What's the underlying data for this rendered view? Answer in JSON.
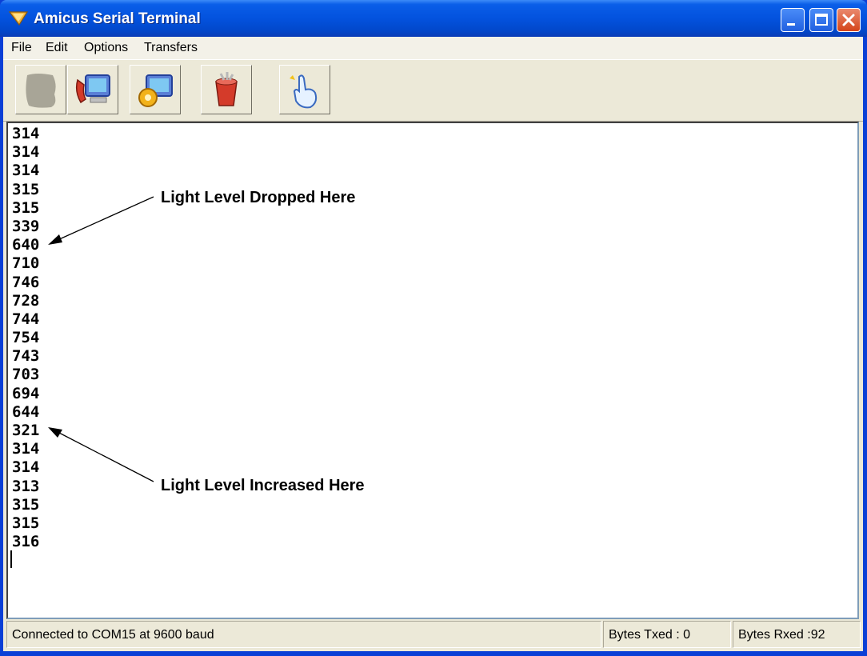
{
  "window": {
    "title": "Amicus Serial Terminal",
    "accent_color": "#0352de"
  },
  "menu": {
    "items": [
      "File",
      "Edit",
      "Options",
      "Transfers"
    ]
  },
  "toolbar": {
    "buttons": [
      {
        "icon": "disconnect-icon"
      },
      {
        "icon": "connect-phone-icon"
      },
      {
        "icon": "settings-gear-icon"
      },
      {
        "icon": "clear-bucket-icon"
      },
      {
        "icon": "hand-pointer-icon"
      }
    ]
  },
  "terminal": {
    "lines": [
      "314",
      "314",
      "314",
      "315",
      "315",
      "339",
      "640",
      "710",
      "746",
      "728",
      "744",
      "754",
      "743",
      "703",
      "694",
      "644",
      "321",
      "314",
      "314",
      "313",
      "315",
      "315",
      "316"
    ],
    "annotations": {
      "dropped": "Light Level Dropped Here",
      "increased": "Light Level Increased Here"
    }
  },
  "status": {
    "connection": "Connected to COM15 at 9600 baud",
    "bytes_txed": "Bytes Txed : 0",
    "bytes_rxed": "Bytes Rxed :92"
  }
}
